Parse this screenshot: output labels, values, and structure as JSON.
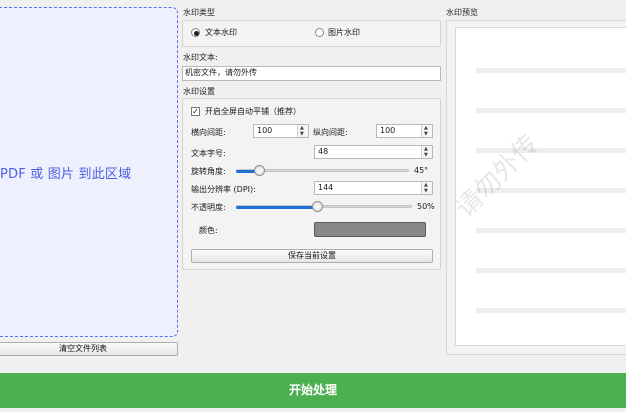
{
  "left_panel": {
    "drop_hint": "PDF 或 图片 到此区域",
    "clear_list_label": "清空文件列表"
  },
  "watermark_type": {
    "title": "水印类型",
    "options": [
      {
        "label": "文本水印",
        "selected": true
      },
      {
        "label": "图片水印",
        "selected": false
      }
    ]
  },
  "watermark_text": {
    "title": "水印文本:",
    "value": "机密文件，请勿外传"
  },
  "settings": {
    "title": "水印设置",
    "tile_checkbox": {
      "label": "开启全屏自动平铺（推荐）",
      "checked": true
    },
    "h_spacing": {
      "label": "横向间距:",
      "value": "100"
    },
    "v_spacing": {
      "label": "纵向间距:",
      "value": "100"
    },
    "font_size": {
      "label": "文本字号:",
      "value": "48"
    },
    "rotation": {
      "label": "旋转角度:",
      "value_text": "45°",
      "fraction": 0.135
    },
    "dpi": {
      "label": "输出分辨率 (DPI):",
      "value": "144"
    },
    "opacity": {
      "label": "不透明度:",
      "value_text": "50%",
      "fraction": 0.46
    },
    "color": {
      "label": "颜色:",
      "value": "#888888"
    },
    "save_label": "保存当前设置"
  },
  "preview": {
    "title": "水印预览",
    "watermark_sample": "请勿外传"
  },
  "start_label": "开始处理"
}
